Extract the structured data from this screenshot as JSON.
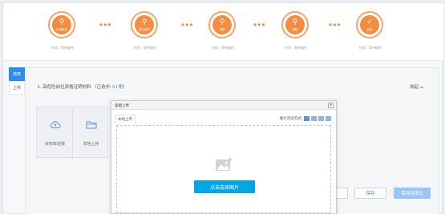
{
  "steps": [
    {
      "label": "申请填写",
      "glyph": "⚲",
      "sub": "时间：等待操作"
    },
    {
      "label": "提交审核",
      "glyph": "⚲",
      "sub": "时间：等待操作"
    },
    {
      "label": "审核",
      "glyph": "⚲",
      "sub": "时间：等待操作"
    },
    {
      "label": "授权",
      "glyph": "⚲",
      "sub": "时间：等待操作"
    },
    {
      "label": "办结",
      "glyph": "✓",
      "sub": "时间：等待操作"
    }
  ],
  "step_separator": "•••",
  "side_tabs": {
    "fill": "填表",
    "upload": "上传"
  },
  "item": {
    "title": "1. 高危险岗位资格证明材料",
    "selected_prefix": "（已选中:",
    "selected_count": "0",
    "selected_suffix": "/ 份）",
    "collapse_label": "收起",
    "collapse_icon": "chevron-up-icon"
  },
  "upload_tiles": {
    "library": "资料库选择",
    "local": "本地上传"
  },
  "buttons": {
    "prev": "",
    "save": "保存",
    "submit": "保存并提交"
  },
  "modal": {
    "title": "多图上传",
    "close_glyph": "×",
    "tab_local": "本地上传",
    "layout_label": "图片浮动方式:",
    "choose_button": "点击选择图片"
  },
  "colors": {
    "accent_orange": "#f48c42",
    "primary_blue": "#2d8cf0",
    "choose_blue": "#00a7e8"
  }
}
